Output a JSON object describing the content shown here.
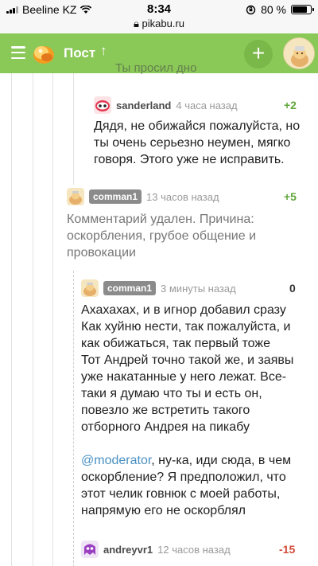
{
  "status_bar": {
    "carrier": "Beeline KZ",
    "time": "8:34",
    "url": "pikabu.ru",
    "battery": "80 %",
    "battery_level": 0.8
  },
  "header": {
    "title": "Пост",
    "up_icon": "↑",
    "add_label": "+"
  },
  "cut_text": "Ты просил дно",
  "comments": [
    {
      "user": "sanderland",
      "time": "4 часа назад",
      "rating": "+2",
      "text": "Дядя, не обижайся пожалуйста, но ты очень серьезно неумен, мягко говоря. Этого уже не исправить."
    },
    {
      "user": "comman1",
      "time": "13 часов назад",
      "rating": "+5",
      "text": "Комментарий удален. Причина: оскорбления, грубое общение и провокации"
    },
    {
      "user": "comman1",
      "time": "3 минуты назад",
      "rating": "0",
      "paragraphs": [
        "Ахахахах, и в игнор добавил сразу",
        "Как хуйню нести, так пожалуйста, и как обижаться, так первый тоже",
        "Тот Андрей точно такой же, и заявы уже накатанные у него лежат. Все-таки я думаю что ты и есть он, повезло же встретить такого отборного Андрея на пикабу"
      ],
      "mention": "@moderator",
      "mention_rest": ", ну-ка, иди сюда, в чем оскорбление? Я предположил, что этот челик говнюк с моей работы, напрямую его не оскорблял"
    },
    {
      "user": "andreyvr1",
      "time": "12 часов назад",
      "rating": "-15"
    }
  ],
  "colors": {
    "header_green": "#8ac858",
    "positive": "#60a63b",
    "negative": "#d44a3a",
    "mention": "#4a90c2"
  }
}
